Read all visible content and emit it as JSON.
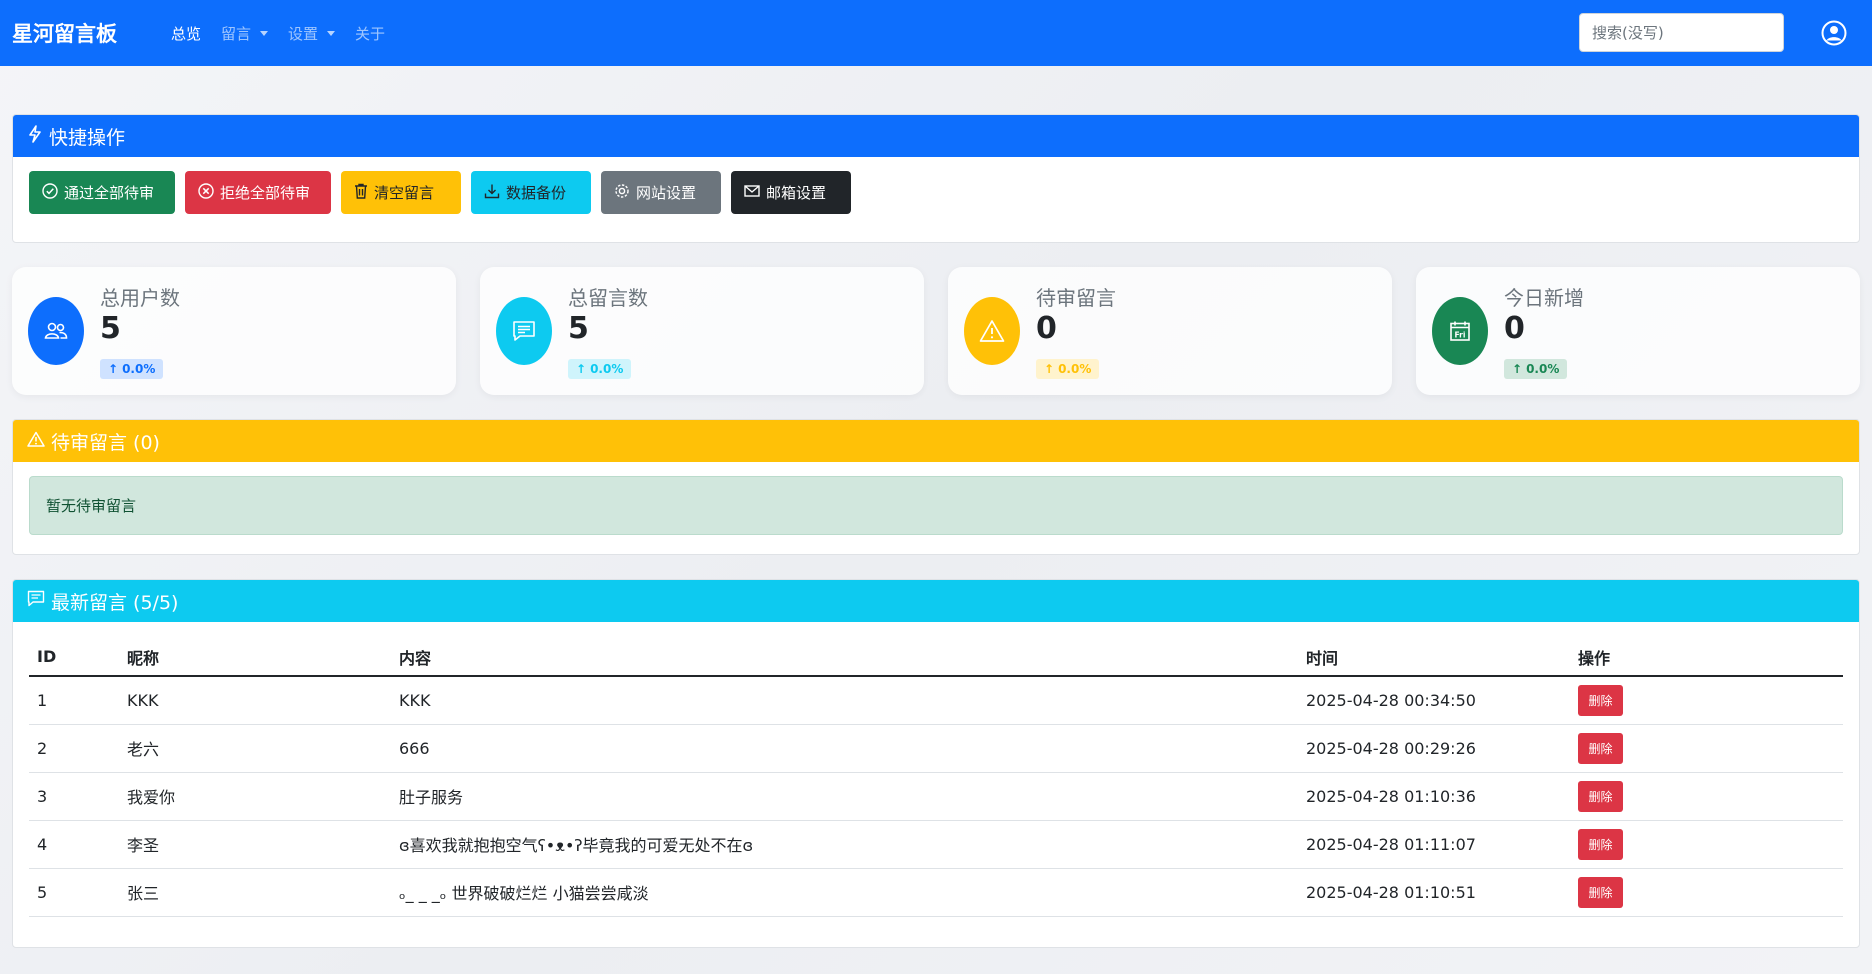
{
  "navbar": {
    "brand": "星河留言板",
    "links": [
      {
        "label": "总览",
        "active": true
      },
      {
        "label": "留言",
        "dropdown": true
      },
      {
        "label": "设置",
        "dropdown": true
      },
      {
        "label": "关于"
      }
    ],
    "search_placeholder": "搜索(没写)"
  },
  "quick_actions": {
    "title": "快捷操作",
    "buttons": [
      {
        "label": "通过全部待审",
        "icon": "check-circle-icon"
      },
      {
        "label": "拒绝全部待审",
        "icon": "x-circle-icon"
      },
      {
        "label": "清空留言",
        "icon": "trash-icon"
      },
      {
        "label": "数据备份",
        "icon": "download-icon"
      },
      {
        "label": "网站设置",
        "icon": "gear-icon"
      },
      {
        "label": "邮箱设置",
        "icon": "envelope-icon"
      }
    ]
  },
  "stats": [
    {
      "label": "总用户数",
      "value": "5",
      "change": "0.0%",
      "icon": "people-icon",
      "color": "#0d6efd"
    },
    {
      "label": "总留言数",
      "value": "5",
      "change": "0.0%",
      "icon": "chat-icon",
      "color": "#0dcaf0"
    },
    {
      "label": "待审留言",
      "value": "0",
      "change": "0.0%",
      "icon": "warning-icon",
      "color": "#ffc107"
    },
    {
      "label": "今日新增",
      "value": "0",
      "change": "0.0%",
      "icon": "calendar-icon",
      "color": "#198754"
    }
  ],
  "pending": {
    "title": "待审留言 (0)",
    "empty_text": "暂无待审留言"
  },
  "latest": {
    "title": "最新留言 (5/5)",
    "columns": [
      "ID",
      "昵称",
      "内容",
      "时间",
      "操作"
    ],
    "rows": [
      {
        "id": "1",
        "nickname": "KKK",
        "content": "KKK",
        "time": "2025-04-28 00:34:50",
        "action": "删除"
      },
      {
        "id": "2",
        "nickname": "老六",
        "content": "666",
        "time": "2025-04-28 00:29:26",
        "action": "删除"
      },
      {
        "id": "3",
        "nickname": "我爱你",
        "content": "肚子服务",
        "time": "2025-04-28 01:10:36",
        "action": "删除"
      },
      {
        "id": "4",
        "nickname": "李圣",
        "content": "ɞ喜欢我就抱抱空气ʕ•ᴥ•ʔ毕竟我的可爱无处不在ɞ",
        "time": "2025-04-28 01:11:07",
        "action": "删除"
      },
      {
        "id": "5",
        "nickname": "张三",
        "content": "ₒ_ _ _ₒ 世界破破烂烂 小猫尝尝咸淡",
        "time": "2025-04-28 01:10:51",
        "action": "删除"
      }
    ]
  },
  "colors": {
    "primary": "#0d6efd",
    "success": "#198754",
    "danger": "#dc3545",
    "warning": "#ffc107",
    "info": "#0dcaf0",
    "secondary": "#6c757d",
    "dark": "#212529"
  }
}
